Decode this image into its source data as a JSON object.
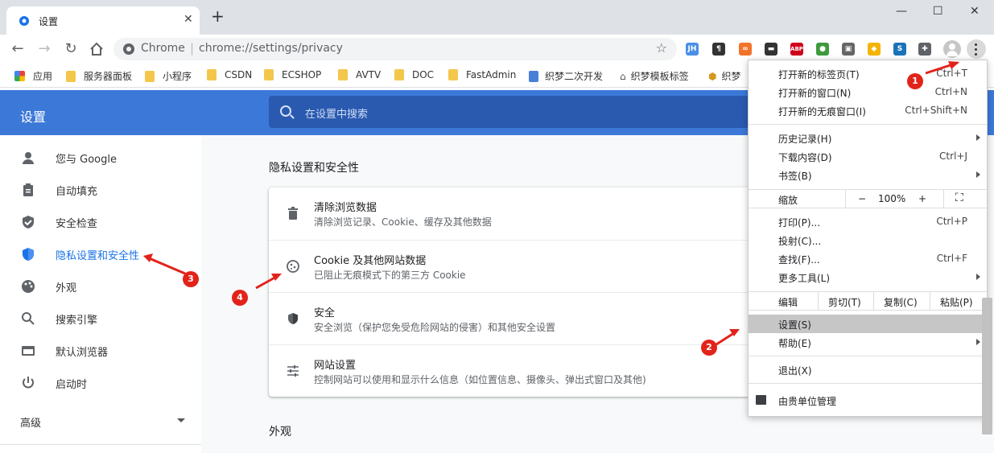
{
  "tab": {
    "title": "设置",
    "close": "✕"
  },
  "newtab": "+",
  "window_controls": {
    "min": "—",
    "max": "☐",
    "close": "✕"
  },
  "omnibox": {
    "host": "Chrome",
    "separator": "|",
    "url": "chrome://settings/privacy",
    "star": "☆"
  },
  "extensions": [
    {
      "name": "jh-ext-icon",
      "text": "JH",
      "color": "#4a8fe7"
    },
    {
      "name": "paragraph-ext-icon",
      "text": "¶",
      "color": "#333333"
    },
    {
      "name": "infinity-ext-icon",
      "text": "∞",
      "color": "#f2742c"
    },
    {
      "name": "mask-ext-icon",
      "text": "▬",
      "color": "#333333"
    },
    {
      "name": "abp-ext-icon",
      "text": "ABP",
      "color": "#d0021b"
    },
    {
      "name": "globe-ext-icon",
      "text": "●",
      "color": "#3d9b3d"
    },
    {
      "name": "window-ext-icon",
      "text": "▣",
      "color": "#666666"
    },
    {
      "name": "colors-ext-icon",
      "text": "◆",
      "color": "#f4b400"
    },
    {
      "name": "s-ext-icon",
      "text": "S",
      "color": "#1a73b8"
    },
    {
      "name": "puzzle-ext-icon",
      "text": "✚",
      "color": "#5f6368"
    }
  ],
  "bookmarks": [
    {
      "label": "应用",
      "type": "apps"
    },
    {
      "label": "服务器面板",
      "type": "folder"
    },
    {
      "label": "小程序",
      "type": "folder"
    },
    {
      "label": "CSDN",
      "type": "folder"
    },
    {
      "label": "ECSHOP",
      "type": "folder"
    },
    {
      "label": "AVTV",
      "type": "folder"
    },
    {
      "label": "DOC",
      "type": "folder"
    },
    {
      "label": "FastAdmin",
      "type": "folder"
    },
    {
      "label": "织梦二次开发",
      "type": "page"
    },
    {
      "label": "织梦模板标签",
      "type": "tag"
    },
    {
      "label": "织梦",
      "type": "gear"
    }
  ],
  "header": {
    "title": "设置",
    "search_placeholder": "在设置中搜索"
  },
  "sidebar": {
    "items": [
      {
        "label": "您与 Google",
        "icon": "person-icon"
      },
      {
        "label": "自动填充",
        "icon": "clipboard-icon"
      },
      {
        "label": "安全检查",
        "icon": "shield-check-icon"
      },
      {
        "label": "隐私设置和安全性",
        "icon": "shield-icon",
        "active": true
      },
      {
        "label": "外观",
        "icon": "palette-icon"
      },
      {
        "label": "搜索引擎",
        "icon": "search-icon"
      },
      {
        "label": "默认浏览器",
        "icon": "browser-icon"
      },
      {
        "label": "启动时",
        "icon": "power-icon"
      }
    ],
    "advanced": "高级"
  },
  "main": {
    "section_title": "隐私设置和安全性",
    "rows": [
      {
        "title": "清除浏览数据",
        "subtitle": "清除浏览记录、Cookie、缓存及其他数据",
        "icon": "trash-icon"
      },
      {
        "title": "Cookie 及其他网站数据",
        "subtitle": "已阻止无痕模式下的第三方 Cookie",
        "icon": "cookie-icon"
      },
      {
        "title": "安全",
        "subtitle": "安全浏览（保护您免受危险网站的侵害）和其他安全设置",
        "icon": "shield-icon"
      },
      {
        "title": "网站设置",
        "subtitle": "控制网站可以使用和显示什么信息（如位置信息、摄像头、弹出式窗口及其他)",
        "icon": "sliders-icon"
      }
    ],
    "section2_title": "外观"
  },
  "menu": {
    "group1": [
      {
        "label": "打开新的标签页(T)",
        "shortcut": "Ctrl+T"
      },
      {
        "label": "打开新的窗口(N)",
        "shortcut": "Ctrl+N"
      },
      {
        "label": "打开新的无痕窗口(I)",
        "shortcut": "Ctrl+Shift+N"
      }
    ],
    "group2": [
      {
        "label": "历史记录(H)",
        "shortcut": "",
        "submenu": true
      },
      {
        "label": "下载内容(D)",
        "shortcut": "Ctrl+J",
        "submenu": false
      },
      {
        "label": "书签(B)",
        "shortcut": "",
        "submenu": true
      }
    ],
    "zoom": {
      "label": "缩放",
      "minus": "−",
      "value": "100%",
      "plus": "+",
      "fullscreen": "⛶"
    },
    "group3": [
      {
        "label": "打印(P)...",
        "shortcut": "Ctrl+P",
        "submenu": false
      },
      {
        "label": "投射(C)...",
        "shortcut": "",
        "submenu": false
      },
      {
        "label": "查找(F)...",
        "shortcut": "Ctrl+F",
        "submenu": false
      },
      {
        "label": "更多工具(L)",
        "shortcut": "",
        "submenu": true
      }
    ],
    "edit": {
      "label": "编辑",
      "cut": "剪切(T)",
      "copy": "复制(C)",
      "paste": "粘贴(P)"
    },
    "group4": [
      {
        "label": "设置(S)",
        "highlighted": true,
        "submenu": false
      },
      {
        "label": "帮助(E)",
        "highlighted": false,
        "submenu": true
      }
    ],
    "exit": "退出(X)",
    "managed": "由贵单位管理"
  },
  "annotations": [
    "1",
    "2",
    "3",
    "4"
  ]
}
